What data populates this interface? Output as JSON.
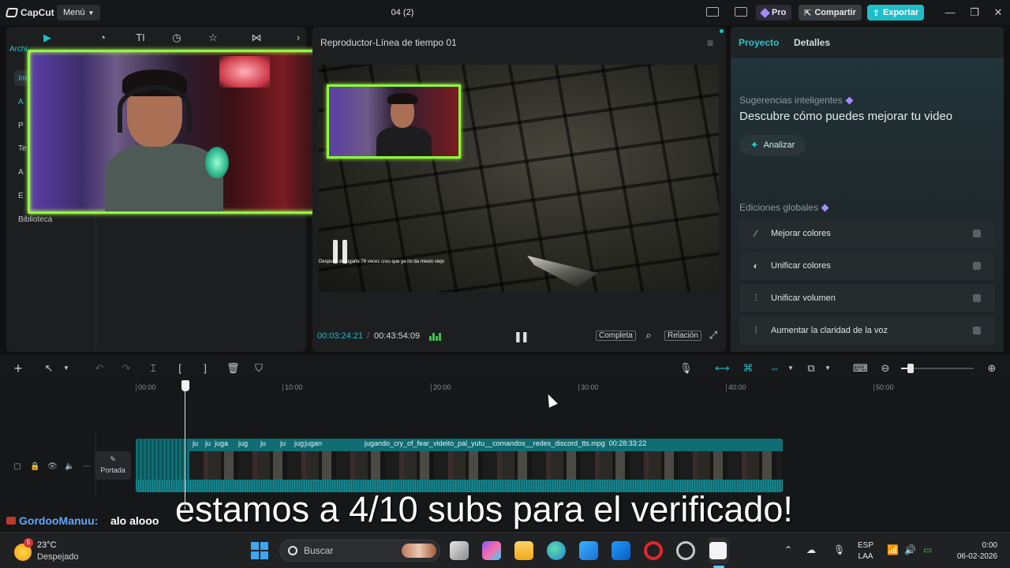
{
  "app": {
    "logo_text": "CapCut",
    "menu_label": "Menú",
    "doc_title": "04 (2)",
    "pro_label": "Pro",
    "share_label": "Compartir",
    "export_label": "Exportar"
  },
  "media": {
    "tab_label": "Archi",
    "side_items": [
      {
        "label": "Im"
      },
      {
        "label": "A"
      },
      {
        "label": "P"
      },
      {
        "label": "Te"
      },
      {
        "label": "A"
      },
      {
        "label": "E"
      },
      {
        "label": "Biblioteca"
      }
    ]
  },
  "player": {
    "title": "Reproductor-Línea de tiempo 01",
    "chat_user": "",
    "chat_text": "Después de jugarle 76 veces creo que ya no da miedo viejo",
    "current_time": "00:03:24:21",
    "total_time": "00:43:54:09",
    "full_label": "Completa",
    "ratio_label": "Relación"
  },
  "properties": {
    "tab_project": "Proyecto",
    "tab_details": "Detalles",
    "smart_label": "Sugerencias inteligentes",
    "smart_title": "Descubre cómo puedes mejorar tu video",
    "analyze_label": "Analizar",
    "global_label": "Ediciones globales",
    "global_items": [
      {
        "label": "Mejorar colores",
        "icon": "wand-icon"
      },
      {
        "label": "Unificar colores",
        "icon": "palette-icon"
      },
      {
        "label": "Unificar volumen",
        "icon": "sliders-icon"
      },
      {
        "label": "Aumentar la claridad de la voz",
        "icon": "voice-wave-icon"
      }
    ]
  },
  "timeline": {
    "ruler": [
      "00:00",
      "10:00",
      "20:00",
      "30:00",
      "40:00",
      "50:00"
    ],
    "cover_label": "Portada",
    "clip_label": "jugando_cry_of_fear_videito_pal_yutu__comandos__redes_discord_tts.mpg",
    "clip_duration": "00:28:33:22",
    "clip_short_labels": [
      "ju",
      "ju",
      "juga",
      "jug",
      "ju",
      "jug",
      "ju",
      "jugan"
    ]
  },
  "overlay": {
    "chat_name": "GordooManuu:",
    "chat_msg": "alo alooo",
    "subtitle": "estamos a 4/10 subs para el verificado!"
  },
  "taskbar": {
    "weather_badge": "5",
    "temperature": "23°C",
    "weather_desc": "Despejado",
    "search_placeholder": "Buscar",
    "lang_top": "ESP",
    "lang_bottom": "LAA",
    "time": "0:00",
    "date": "06-02-2026"
  },
  "colors": {
    "accent": "#1dbec8",
    "neon_frame": "#8cff3a",
    "pro_gem": "#a78bfa"
  }
}
